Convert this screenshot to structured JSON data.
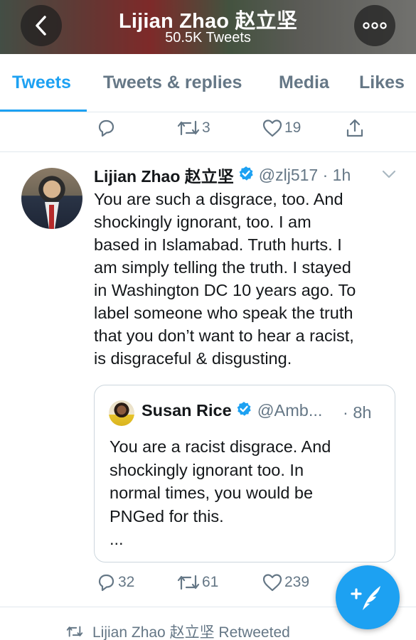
{
  "header": {
    "title": "Lijian Zhao 赵立坚",
    "subtitle": "50.5K Tweets"
  },
  "tabs": [
    {
      "label": "Tweets",
      "active": true
    },
    {
      "label": "Tweets & replies",
      "active": false
    },
    {
      "label": "Media",
      "active": false
    },
    {
      "label": "Likes",
      "active": false
    }
  ],
  "prev_tweet_actions": {
    "reply_count": "",
    "retweet_count": "3",
    "like_count": "19"
  },
  "tweet": {
    "author_name": "Lijian Zhao 赵立坚",
    "verified": true,
    "handle_time": "@zlj517 · 1h",
    "text": "You are such a disgrace, too. And\nshockingly ignorant, too. I am\nbased in Islamabad. Truth hurts. I\nam simply telling the truth. I  stayed\nin Washington DC 10 years ago. To\nlabel someone who speak the truth\nthat you don’t want to hear a racist,\nis disgraceful & disgusting.",
    "quoted": {
      "author_name": "Susan Rice",
      "verified": true,
      "handle": "@Amb...",
      "time": "· 8h",
      "text": "You are a racist disgrace. And\nshockingly ignorant too. In\nnormal times, you would be\nPNGed for this.\n..."
    },
    "actions": {
      "reply_count": "32",
      "retweet_count": "61",
      "like_count": "239"
    }
  },
  "next_tweet": {
    "retweeted_by": "Lijian Zhao 赵立坚 Retweeted"
  },
  "colors": {
    "accent": "#1da1f2",
    "secondary_text": "#657786",
    "divider": "#e1e8ed"
  },
  "icons": [
    "back-chevron-icon",
    "more-dots-icon",
    "reply-icon",
    "retweet-icon",
    "like-heart-icon",
    "share-icon",
    "verified-badge-icon",
    "caret-down-icon",
    "compose-feather-icon"
  ]
}
